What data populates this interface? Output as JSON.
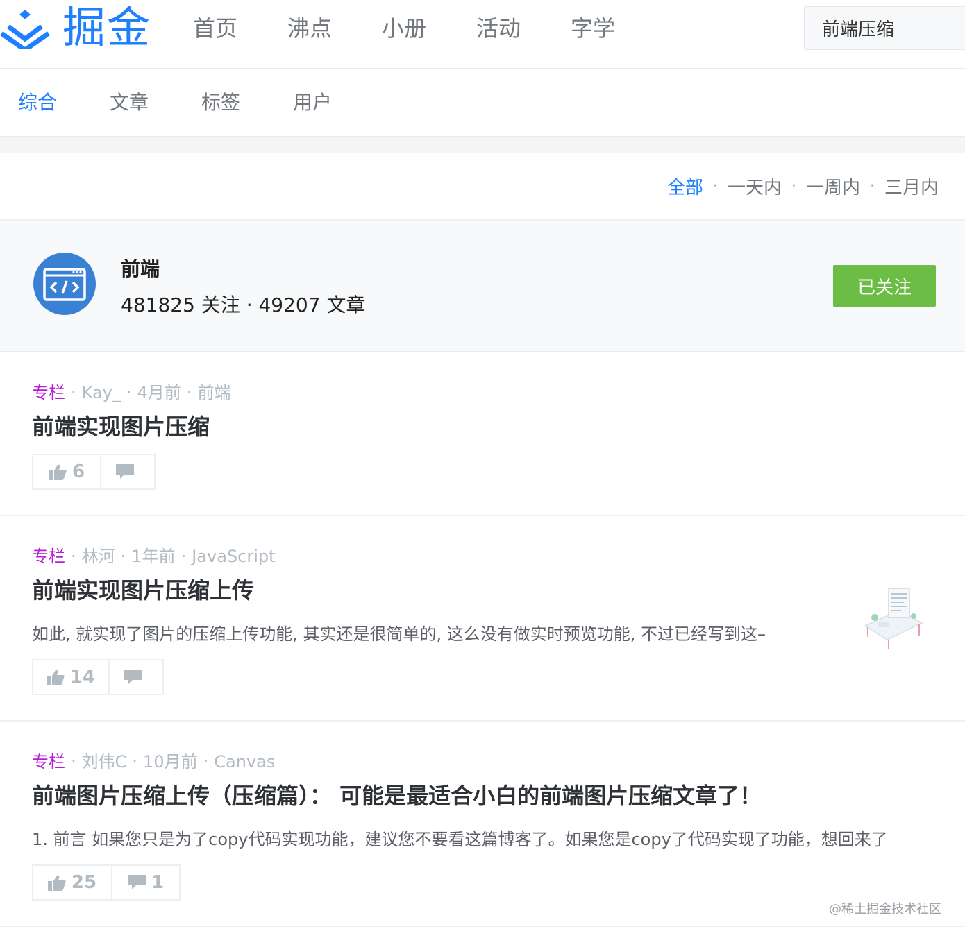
{
  "header": {
    "logo_text": "掘金",
    "nav": [
      "首页",
      "沸点",
      "小册",
      "活动",
      "字学"
    ],
    "search_value": "前端压缩"
  },
  "subnav": {
    "tabs": [
      "综合",
      "文章",
      "标签",
      "用户"
    ],
    "active": "综合"
  },
  "filter": {
    "items": [
      "全部",
      "一天内",
      "一周内",
      "三月内"
    ],
    "active": "全部"
  },
  "tag": {
    "name": "前端",
    "stats": "481825 关注 · 49207 文章",
    "follow_label": "已关注"
  },
  "articles": [
    {
      "column": "专栏",
      "author": "Kay_",
      "time": "4月前",
      "tag": "前端",
      "title": "前端实现图片压缩",
      "abstract": "",
      "likes": "6",
      "comments": ""
    },
    {
      "column": "专栏",
      "author": "林河",
      "time": "1年前",
      "tag": "JavaScript",
      "title": "前端实现图片压缩上传",
      "abstract": "如此, 就实现了图片的压缩上传功能, 其实还是很简单的, 这么没有做实时预览功能, 不过已经写到这–",
      "likes": "14",
      "comments": ""
    },
    {
      "column": "专栏",
      "author": "刘伟C",
      "time": "10月前",
      "tag": "Canvas",
      "title": "前端图片压缩上传（压缩篇）： 可能是最适合小白的前端图片压缩文章了！",
      "abstract": "1. 前言 如果您只是为了copy代码实现功能，建议您不要看这篇博客了。如果您是copy了代码实现了功能，想回来了",
      "likes": "25",
      "comments": "1"
    }
  ],
  "watermark": "@稀土掘金技术社区",
  "colors": {
    "accent": "#1e80ff",
    "follow": "#6cbd45",
    "column": "#b71ed7"
  }
}
